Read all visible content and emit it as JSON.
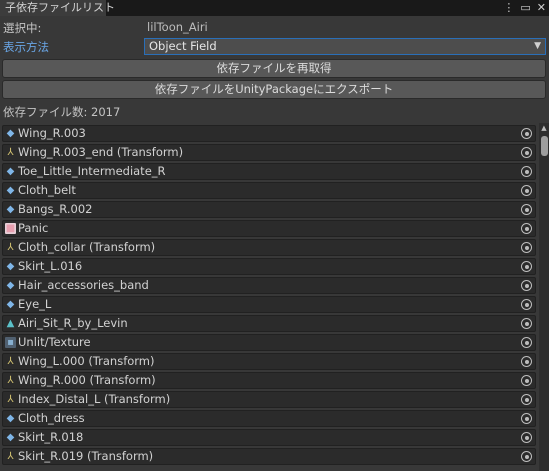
{
  "window": {
    "tab_title": "子依存ファイルリスト",
    "controls": {
      "menu": "⋮",
      "maximize": "▭",
      "close": "✕"
    }
  },
  "fields": {
    "selected_label": "選択中:",
    "selected_value": "lilToon_Airi",
    "display_label": "表示方法",
    "display_value": "Object Field"
  },
  "buttons": {
    "refresh": "依存ファイルを再取得",
    "export": "依存ファイルをUnityPackageにエクスポート"
  },
  "count_text": "依存ファイル数: 2017",
  "items": [
    {
      "label": "Wing_R.003",
      "icon": "mesh-icon"
    },
    {
      "label": "Wing_R.003_end (Transform)",
      "icon": "transform-icon"
    },
    {
      "label": "Toe_Little_Intermediate_R",
      "icon": "mesh-icon"
    },
    {
      "label": "Cloth_belt",
      "icon": "mesh-icon"
    },
    {
      "label": "Bangs_R.002",
      "icon": "mesh-icon"
    },
    {
      "label": "Panic",
      "icon": "texture-icon"
    },
    {
      "label": "Cloth_collar (Transform)",
      "icon": "transform-icon"
    },
    {
      "label": "Skirt_L.016",
      "icon": "mesh-icon"
    },
    {
      "label": "Hair_accessories_band",
      "icon": "mesh-icon"
    },
    {
      "label": "Eye_L",
      "icon": "mesh-icon"
    },
    {
      "label": "Airi_Sit_R_by_Levin",
      "icon": "animation-icon"
    },
    {
      "label": "Unlit/Texture",
      "icon": "shader-icon"
    },
    {
      "label": "Wing_L.000 (Transform)",
      "icon": "transform-icon"
    },
    {
      "label": "Wing_R.000 (Transform)",
      "icon": "transform-icon"
    },
    {
      "label": "Index_Distal_L (Transform)",
      "icon": "transform-icon"
    },
    {
      "label": "Cloth_dress",
      "icon": "mesh-icon"
    },
    {
      "label": "Skirt_R.018",
      "icon": "mesh-icon"
    },
    {
      "label": "Skirt_R.019 (Transform)",
      "icon": "transform-icon"
    }
  ]
}
